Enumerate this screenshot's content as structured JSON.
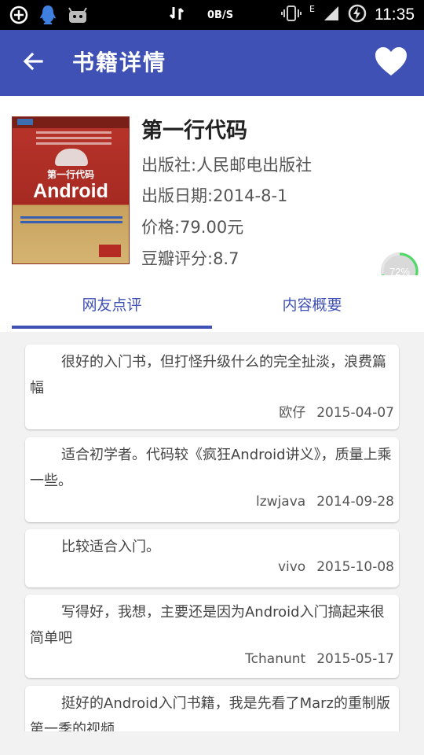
{
  "status_bar": {
    "net_speed": "0B/S",
    "network_type": "E",
    "time": "11:35",
    "icons": [
      "add-circle-icon",
      "qq-icon",
      "android-debug-icon",
      "data-sync-icon",
      "vibrate-icon",
      "signal-icon",
      "charging-icon"
    ]
  },
  "toolbar": {
    "title": "书籍详情",
    "back_icon": "arrow-back-icon",
    "favorite_icon": "heart-icon",
    "color": "#3f51b5"
  },
  "book": {
    "title": "第一行代码",
    "publisher": "出版社:人民邮电出版社",
    "pub_date": "出版日期:2014-8-1",
    "price": "价格:79.00元",
    "douban_rating": "豆瓣评分:8.7",
    "cover": {
      "subtitle": "第一行代码",
      "title": "Android"
    }
  },
  "progress": {
    "label": "72%",
    "value": 0.72
  },
  "tabs": [
    {
      "label": "网友点评",
      "selected": true
    },
    {
      "label": "内容概要",
      "selected": false
    }
  ],
  "reviews": [
    {
      "text": "很好的入门书，但打怪升级什么的完全扯淡，浪费篇幅",
      "author": "欧仔",
      "date": "2015-04-07"
    },
    {
      "text": "适合初学者。代码较《疯狂Android讲义》，质量上乘一些。",
      "author": "lzwjava",
      "date": "2014-09-28"
    },
    {
      "text": "比较适合入门。",
      "author": "vivo",
      "date": "2015-10-08"
    },
    {
      "text": "写得好，我想，主要还是因为Android入门搞起来很简单吧",
      "author": "Tchanunt",
      "date": "2015-05-17"
    },
    {
      "text": "挺好的Android入门书籍，我是先看了Marz的重制版第一季的视频",
      "author": "",
      "date": ""
    }
  ]
}
